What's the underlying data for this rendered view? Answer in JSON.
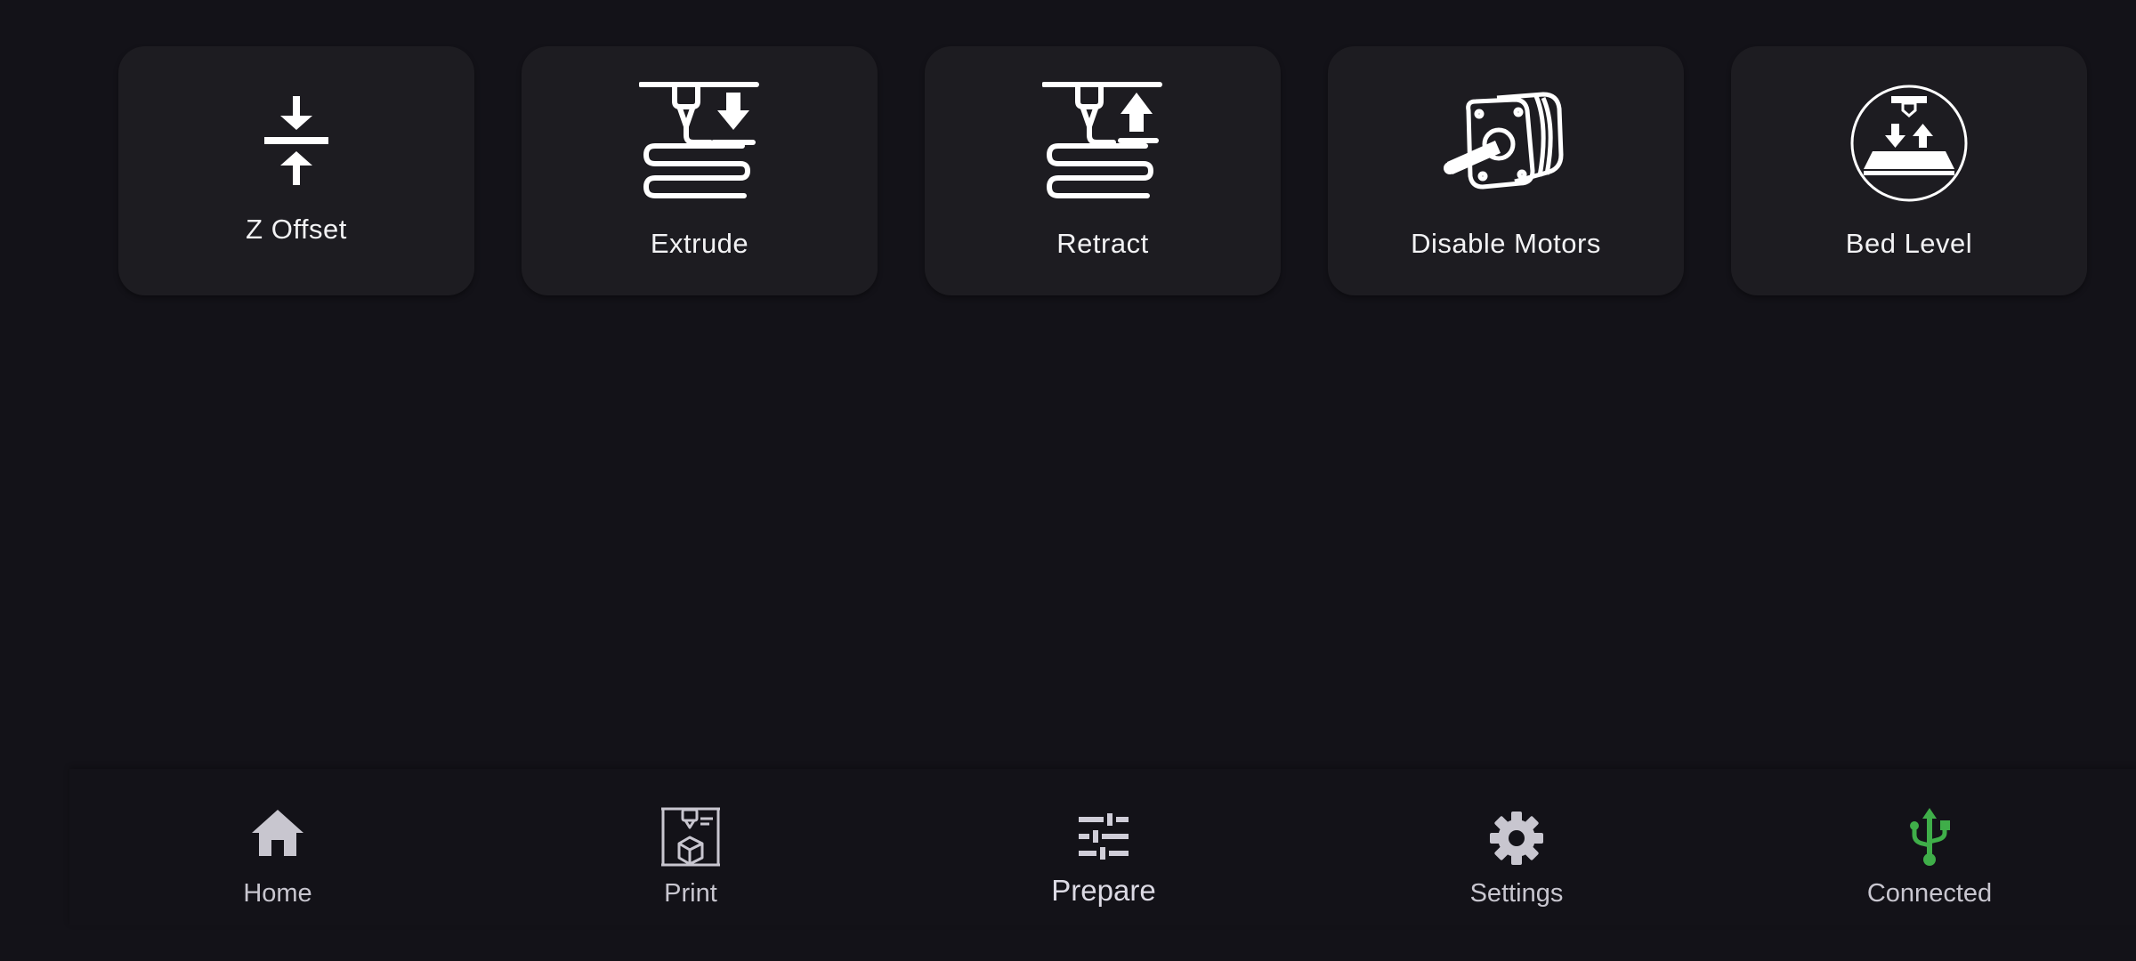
{
  "actions": [
    {
      "label": "Z Offset",
      "icon": "z-offset-icon"
    },
    {
      "label": "Extrude",
      "icon": "extrude-icon"
    },
    {
      "label": "Retract",
      "icon": "retract-icon"
    },
    {
      "label": "Disable Motors",
      "icon": "stepper-motor-icon"
    },
    {
      "label": "Bed Level",
      "icon": "bed-level-icon"
    }
  ],
  "nav": [
    {
      "label": "Home",
      "icon": "home-icon"
    },
    {
      "label": "Print",
      "icon": "print-icon"
    },
    {
      "label": "Prepare",
      "icon": "sliders-icon",
      "active": true
    },
    {
      "label": "Settings",
      "icon": "gear-icon"
    },
    {
      "label": "Connected",
      "icon": "usb-icon"
    }
  ],
  "colors": {
    "background": "#131218",
    "tile": "#1d1c21",
    "connected": "#3fae49",
    "nav_label": "#c8c6cf"
  }
}
